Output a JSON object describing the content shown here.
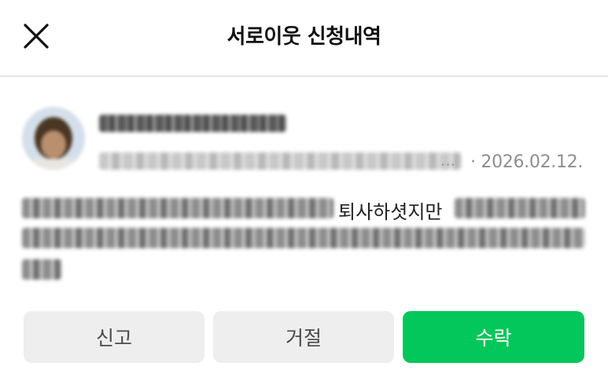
{
  "header": {
    "title": "서로이웃 신청내역",
    "close_icon": "close-icon"
  },
  "request": {
    "date": "· 2026.02.12.",
    "ellipsis": "...",
    "message_visible_fragment": "퇴사하셧지만"
  },
  "actions": {
    "report_label": "신고",
    "reject_label": "거절",
    "accept_label": "수락"
  },
  "colors": {
    "accent": "#03c75a",
    "button_gray": "#eeeeee",
    "divider": "#e6e6e6",
    "date_text": "#8e8e8e"
  }
}
